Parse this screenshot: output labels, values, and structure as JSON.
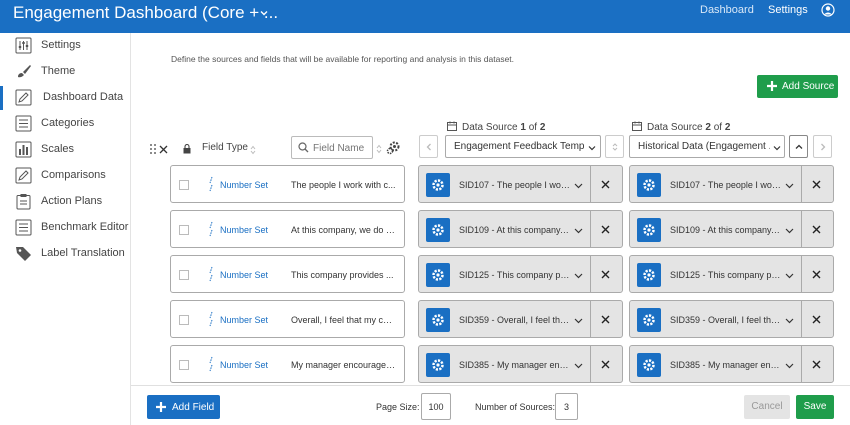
{
  "header": {
    "title": "Engagement Dashboard (Core + ...",
    "nav": [
      "Dashboard",
      "Settings"
    ],
    "colors": {
      "brand": "#1a6fc3",
      "accent_green": "#1f9d4b"
    }
  },
  "sidebar": {
    "items": [
      {
        "label": "Settings",
        "icon": "sliders-icon"
      },
      {
        "label": "Theme",
        "icon": "paint-brush-icon"
      },
      {
        "label": "Dashboard Data",
        "icon": "pencil-icon",
        "active": true
      },
      {
        "label": "Categories",
        "icon": "list-icon"
      },
      {
        "label": "Scales",
        "icon": "bar-chart-icon"
      },
      {
        "label": "Comparisons",
        "icon": "pencil-icon"
      },
      {
        "label": "Action Plans",
        "icon": "clipboard-icon"
      },
      {
        "label": "Benchmark Editor",
        "icon": "list-icon"
      },
      {
        "label": "Label Translation",
        "icon": "tag-icon"
      }
    ]
  },
  "main": {
    "description": "Define the sources and fields that will be available for reporting and analysis in this dataset.",
    "add_source_label": "Add Source",
    "field_type_header": "Field Type",
    "field_name_placeholder": "Field Name",
    "sources": [
      {
        "prefix": "Data Source ",
        "index": "1",
        "middle": " of ",
        "total": "2",
        "selected": "Engagement Feedback Templ..."
      },
      {
        "prefix": "Data Source ",
        "index": "2",
        "middle": " of ",
        "total": "2",
        "selected": "Historical Data (Engagement ..."
      }
    ],
    "rows": [
      {
        "type": "Number Set",
        "name": "The people I work with c...",
        "map1": "SID107 - The people I work ...",
        "map2": "SID107 - The people I work ..."
      },
      {
        "type": "Number Set",
        "name": "At this company, we do a...",
        "map1": "SID109 - At this company, ...",
        "map2": "SID109 - At this company, ..."
      },
      {
        "type": "Number Set",
        "name": "This company provides ...",
        "map1": "SID125 - This company pro...",
        "map2": "SID125 - This company pro..."
      },
      {
        "type": "Number Set",
        "name": "Overall, I feel that my car...",
        "map1": "SID359 - Overall, I feel that...",
        "map2": "SID359 - Overall, I feel that..."
      },
      {
        "type": "Number Set",
        "name": "My manager encourages...",
        "map1": "SID385 - My manager enc...",
        "map2": "SID385 - My manager enc..."
      }
    ]
  },
  "footer": {
    "add_field_label": "Add Field",
    "page_size_label": "Page Size:",
    "page_size_value": "100",
    "num_sources_label": "Number of Sources:",
    "num_sources_value": "3",
    "cancel_label": "Cancel",
    "save_label": "Save"
  }
}
